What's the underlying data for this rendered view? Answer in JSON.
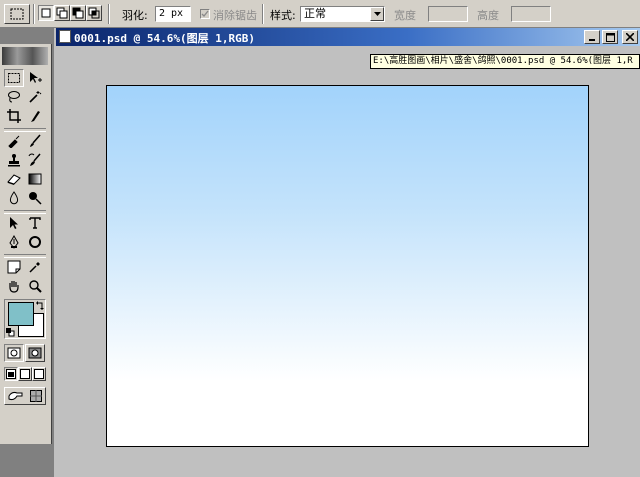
{
  "options_bar": {
    "feather_label": "羽化:",
    "feather_value": "2 px",
    "antialias_label": "消除锯齿",
    "style_label": "样式:",
    "style_value": "正常",
    "width_label": "宽度",
    "height_label": "高度"
  },
  "document": {
    "title": "0001.psd @ 54.6%(图层 1,RGB)",
    "path": "E:\\高胜图画\\相片\\盛舍\\鸽照\\0001.psd @ 54.6%(图层 1,R"
  },
  "colors": {
    "foreground": "#80c0c8",
    "background": "#ffffff",
    "title_bar": "#0a246a",
    "canvas_top": "#a2d3fb"
  },
  "icons": {
    "tools": [
      "marquee",
      "move",
      "lasso",
      "magic-wand",
      "crop",
      "slice",
      "healing-brush",
      "brush",
      "clone-stamp",
      "history-brush",
      "eraser",
      "gradient",
      "blur",
      "dodge",
      "path-selection",
      "type",
      "pen",
      "shape",
      "notes",
      "eyedropper",
      "hand",
      "zoom"
    ]
  }
}
